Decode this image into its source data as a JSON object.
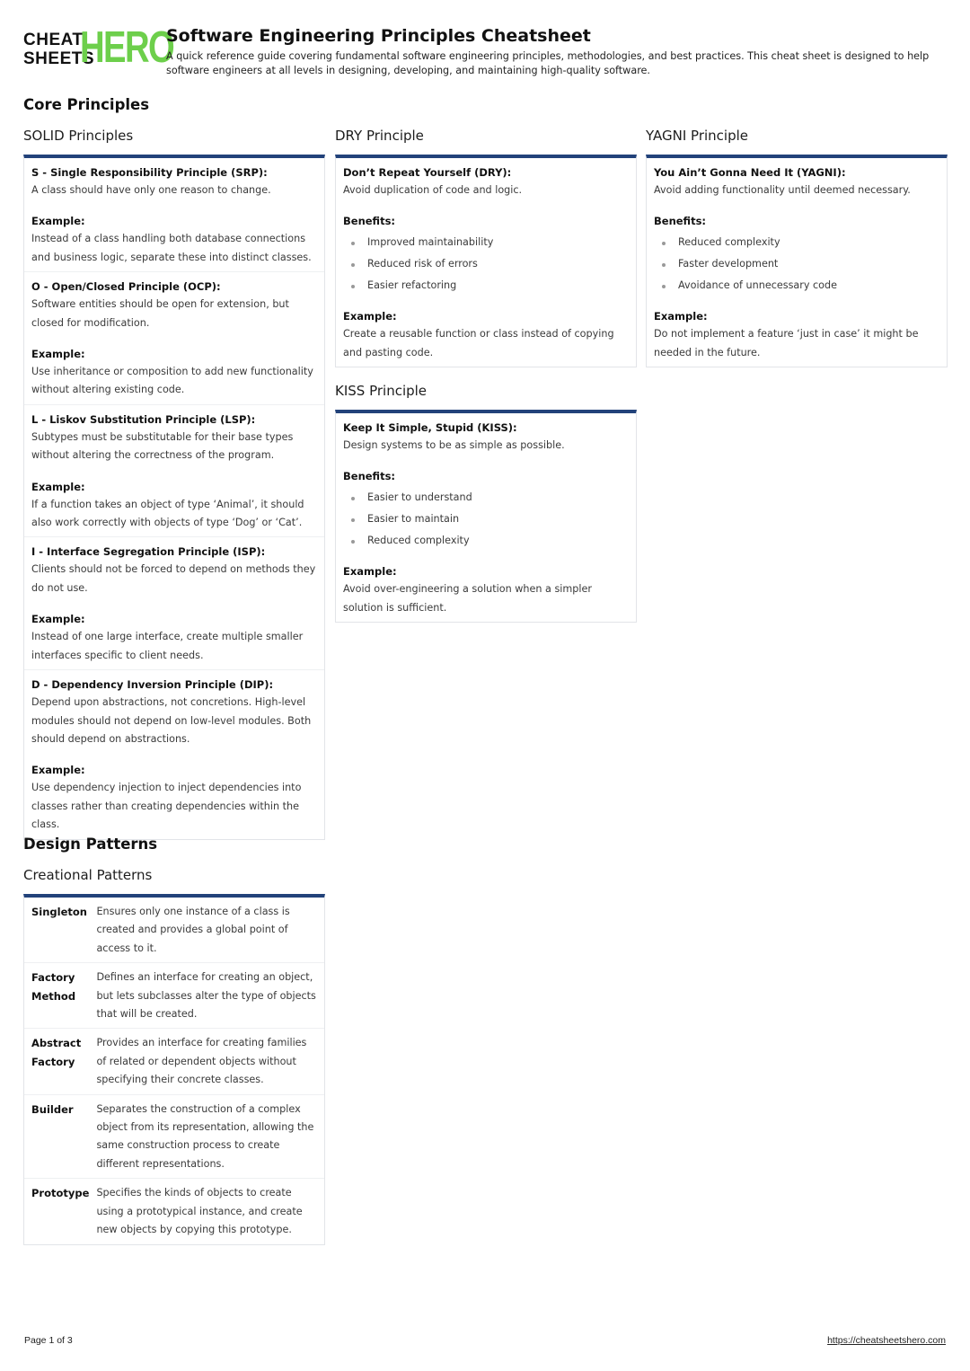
{
  "header": {
    "logo_top": "CHEAT",
    "logo_bottom": "SHEETS",
    "logo_hero": "HERO",
    "title": "Software Engineering Principles Cheatsheet",
    "subtitle": "A quick reference guide covering fundamental software engineering principles, methodologies, and best practices. This cheat sheet is designed to help software engineers at all levels in designing, developing, and maintaining high-quality software.",
    "brand_color": "#6dcf4b",
    "accent_color": "#22427a"
  },
  "core": {
    "heading": "Core Principles",
    "solid": {
      "title": "SOLID Principles",
      "items": [
        {
          "term": "S - Single Responsibility Principle (SRP):",
          "desc": "A class should have only one reason to change.",
          "example_label": "Example:",
          "example": "Instead of a class handling both database connections and business logic, separate these into distinct classes."
        },
        {
          "term": "O - Open/Closed Principle (OCP):",
          "desc": "Software entities should be open for extension, but closed for modification.",
          "example_label": "Example:",
          "example": "Use inheritance or composition to add new functionality without altering existing code."
        },
        {
          "term": "L - Liskov Substitution Principle (LSP):",
          "desc": "Subtypes must be substitutable for their base types without altering the correctness of the program.",
          "example_label": "Example:",
          "example": "If a function takes an object of type ‘Animal’, it should also work correctly with objects of type ‘Dog’ or ‘Cat’."
        },
        {
          "term": "I - Interface Segregation Principle (ISP):",
          "desc": "Clients should not be forced to depend on methods they do not use.",
          "example_label": "Example:",
          "example": "Instead of one large interface, create multiple smaller interfaces specific to client needs."
        },
        {
          "term": "D - Dependency Inversion Principle (DIP):",
          "desc": "Depend upon abstractions, not concretions. High-level modules should not depend on low-level modules. Both should depend on abstractions.",
          "example_label": "Example:",
          "example": "Use dependency injection to inject dependencies into classes rather than creating dependencies within the class."
        }
      ]
    },
    "dry": {
      "title": "DRY Principle",
      "term": "Don’t Repeat Yourself (DRY):",
      "desc": "Avoid duplication of code and logic.",
      "benefits_label": "Benefits:",
      "benefits": [
        "Improved maintainability",
        "Reduced risk of errors",
        "Easier refactoring"
      ],
      "example_label": "Example:",
      "example": "Create a reusable function or class instead of copying and pasting code."
    },
    "yagni": {
      "title": "YAGNI Principle",
      "term": "You Ain’t Gonna Need It (YAGNI):",
      "desc": "Avoid adding functionality until deemed necessary.",
      "benefits_label": "Benefits:",
      "benefits": [
        "Reduced complexity",
        "Faster development",
        "Avoidance of unnecessary code"
      ],
      "example_label": "Example:",
      "example": "Do not implement a feature ‘just in case’ it might be needed in the future."
    },
    "kiss": {
      "title": "KISS Principle",
      "term": "Keep It Simple, Stupid (KISS):",
      "desc": "Design systems to be as simple as possible.",
      "benefits_label": "Benefits:",
      "benefits": [
        "Easier to understand",
        "Easier to maintain",
        "Reduced complexity"
      ],
      "example_label": "Example:",
      "example": "Avoid over-engineering a solution when a simpler solution is sufficient."
    }
  },
  "patterns": {
    "heading": "Design Patterns",
    "creational": {
      "title": "Creational Patterns",
      "rows": [
        {
          "name": "Singleton",
          "desc": "Ensures only one instance of a class is created and provides a global point of access to it."
        },
        {
          "name": "Factory Method",
          "desc": "Defines an interface for creating an object, but lets subclasses alter the type of objects that will be created."
        },
        {
          "name": "Abstract Factory",
          "desc": "Provides an interface for creating families of related or dependent objects without specifying their concrete classes."
        },
        {
          "name": "Builder",
          "desc": "Separates the construction of a complex object from its representation, allowing the same construction process to create different representations."
        },
        {
          "name": "Prototype",
          "desc": "Specifies the kinds of objects to create using a prototypical instance, and create new objects by copying this prototype."
        }
      ]
    }
  },
  "footer": {
    "page": "Page 1 of 3",
    "link": "https://cheatsheetshero.com"
  }
}
